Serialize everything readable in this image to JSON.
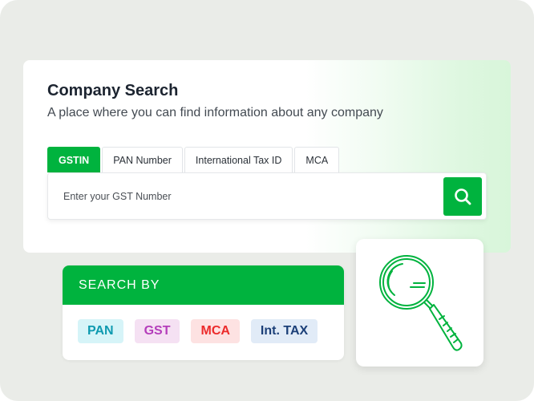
{
  "company_search": {
    "title": "Company Search",
    "subtitle": "A place where you can find information about any company",
    "tabs": [
      {
        "label": "GSTIN",
        "active": true
      },
      {
        "label": "PAN Number",
        "active": false
      },
      {
        "label": "International Tax ID",
        "active": false
      },
      {
        "label": "MCA",
        "active": false
      }
    ],
    "search": {
      "placeholder": "Enter your GST Number",
      "button_icon": "search-icon"
    }
  },
  "search_by": {
    "header": "SEARCH BY",
    "chips": [
      {
        "label": "PAN",
        "color": "#0e9ab0",
        "bg": "#d6f4f8"
      },
      {
        "label": "GST",
        "color": "#b43dbb",
        "bg": "#f5e1f3"
      },
      {
        "label": "MCA",
        "color": "#ec2b2b",
        "bg": "#fde2e2"
      },
      {
        "label": "Int. TAX",
        "color": "#1b3f78",
        "bg": "#e1ebf7"
      }
    ]
  },
  "illustration": {
    "icon": "magnifying-glass-icon"
  },
  "colors": {
    "accent": "#00b33e",
    "background": "#eaece8"
  }
}
